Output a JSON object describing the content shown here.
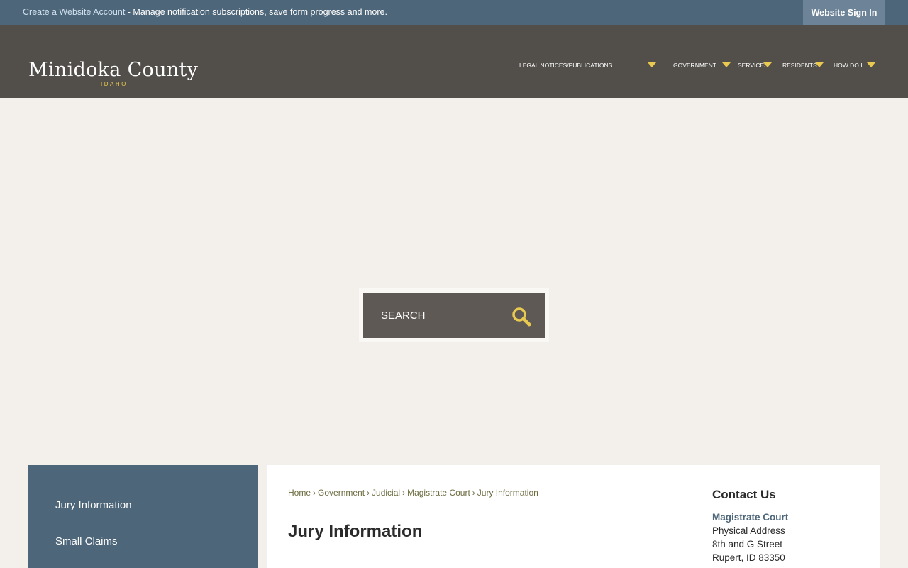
{
  "topbar": {
    "create_account_link": "Create a Website Account",
    "message": " - Manage notification subscriptions, save form progress and more.",
    "sign_in_button": "Website Sign In"
  },
  "logo": {
    "name": "Minidoka County",
    "state": "IDAHO"
  },
  "nav": {
    "items": [
      {
        "label": "LEGAL NOTICES/PUBLICATIONS"
      },
      {
        "label": "GOVERNMENT"
      },
      {
        "label": "SERVICES"
      },
      {
        "label": "RESIDENTS"
      },
      {
        "label": "HOW DO I..."
      }
    ]
  },
  "search": {
    "placeholder": "SEARCH",
    "icon": "search-icon"
  },
  "sidebar": {
    "items": [
      {
        "label": "Jury Information"
      },
      {
        "label": "Small Claims"
      }
    ]
  },
  "breadcrumb": {
    "items": [
      "Home",
      "Government",
      "Judicial",
      "Magistrate Court",
      "Jury Information"
    ],
    "separator": "›"
  },
  "page": {
    "title": "Jury Information"
  },
  "contact": {
    "heading": "Contact Us",
    "department": "Magistrate Court",
    "address_label": "Physical Address",
    "street": "8th and G Street",
    "city": "Rupert, ID 83350"
  },
  "colors": {
    "topbar": "#4e6679",
    "header": "#524f4b",
    "accent": "#e9c94f",
    "background": "#f3f0eb"
  }
}
